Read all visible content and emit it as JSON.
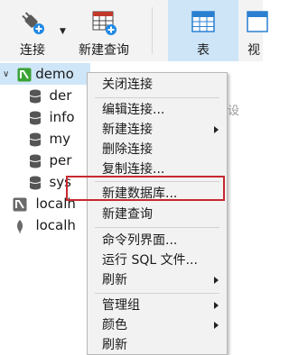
{
  "toolbar": {
    "connect_label": "连接",
    "new_query_label": "新建查询",
    "table_label": "表",
    "view_label": "视"
  },
  "tree": {
    "items": [
      {
        "label": "demo"
      },
      {
        "label": "der"
      },
      {
        "label": "info"
      },
      {
        "label": "my"
      },
      {
        "label": "per"
      },
      {
        "label": "sys"
      },
      {
        "label": "localh"
      },
      {
        "label": "localh"
      }
    ]
  },
  "right_hint": "设",
  "context_menu": {
    "items": [
      {
        "label": "关闭连接"
      },
      {
        "label": "编辑连接..."
      },
      {
        "label": "新建连接"
      },
      {
        "label": "删除连接"
      },
      {
        "label": "复制连接..."
      },
      {
        "label": "新建数据库..."
      },
      {
        "label": "新建查询"
      },
      {
        "label": "命令列界面..."
      },
      {
        "label": "运行 SQL 文件..."
      },
      {
        "label": "刷新"
      },
      {
        "label": "管理组"
      },
      {
        "label": "颜色"
      },
      {
        "label": "刷新"
      }
    ],
    "highlighted_item": "新建数据库..."
  },
  "colors": {
    "highlight_border": "#c8282f",
    "selection_bg": "#cfe6f8",
    "mysql_green": "#3aa335"
  }
}
